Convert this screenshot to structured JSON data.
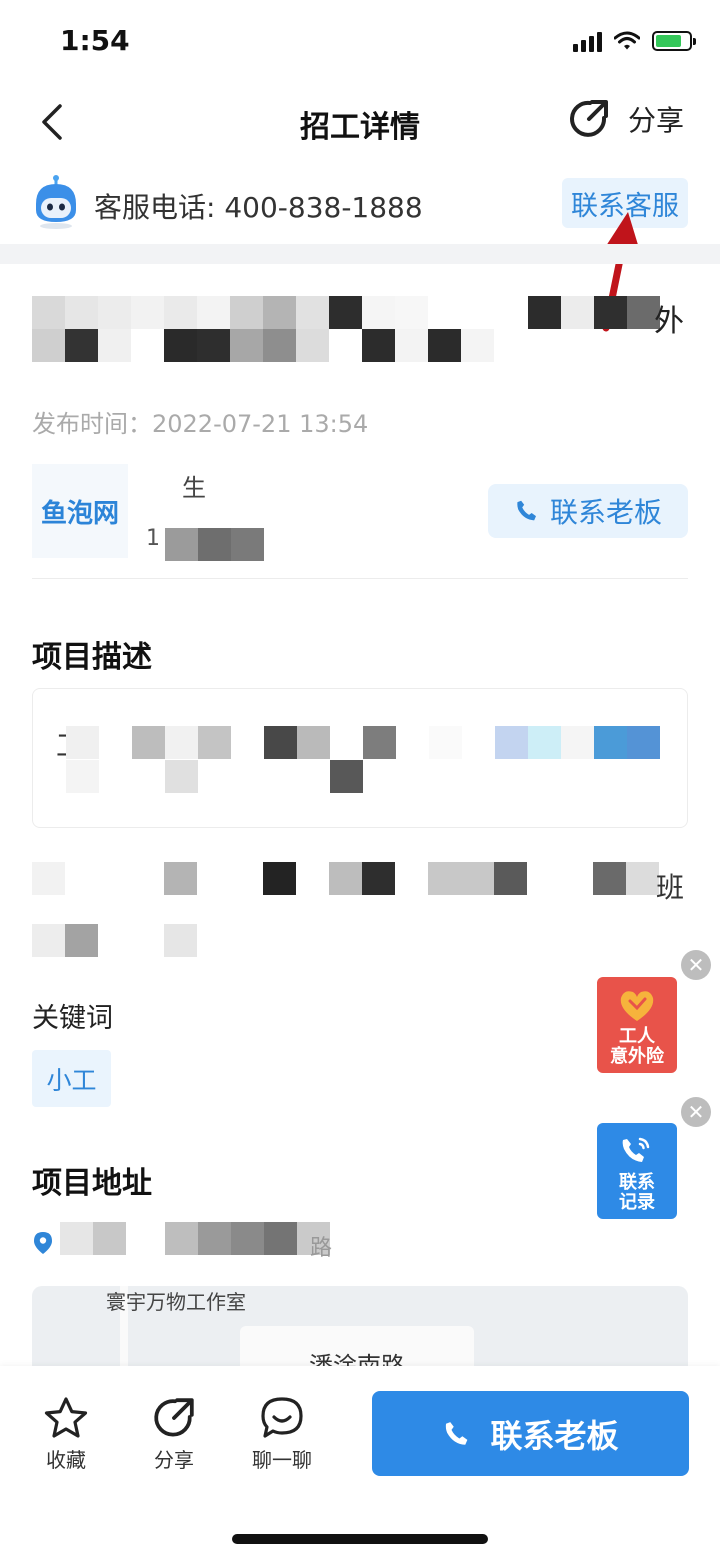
{
  "status_bar": {
    "time": "1:54"
  },
  "nav": {
    "title": "招工详情",
    "share_label": "分享"
  },
  "service": {
    "phone_text": "客服电话: 400-838-1888",
    "contact_button": "联系客服"
  },
  "job": {
    "title_tail_char": "外",
    "publish_time": "发布时间：2022-07-21 13:54",
    "brand": "鱼泡网",
    "boss_name_fragment": "生",
    "boss_phone_fragment": "1",
    "contact_boss_button": "联系老板"
  },
  "sections": {
    "description_title": "项目描述",
    "description_box_prefix": "工",
    "description_tail_char": "班",
    "keyword_label": "关键词",
    "keywords": [
      "小工"
    ],
    "address_title": "项目地址",
    "address_tail_char": "路"
  },
  "map": {
    "poi": "寰宇万物工作室",
    "road": "潘涂南路"
  },
  "float_buttons": {
    "insurance": {
      "line1": "工人",
      "line2": "意外险",
      "color": "#e8534a"
    },
    "records": {
      "line1": "联系",
      "line2": "记录",
      "color": "#2e8ae6"
    }
  },
  "bottom_bar": {
    "favorite": "收藏",
    "share": "分享",
    "chat": "聊一聊",
    "cta": "联系老板"
  },
  "colors": {
    "accent": "#2e8ae6",
    "accent_light": "#e8f3fd",
    "annotation_arrow": "#c0141b"
  }
}
